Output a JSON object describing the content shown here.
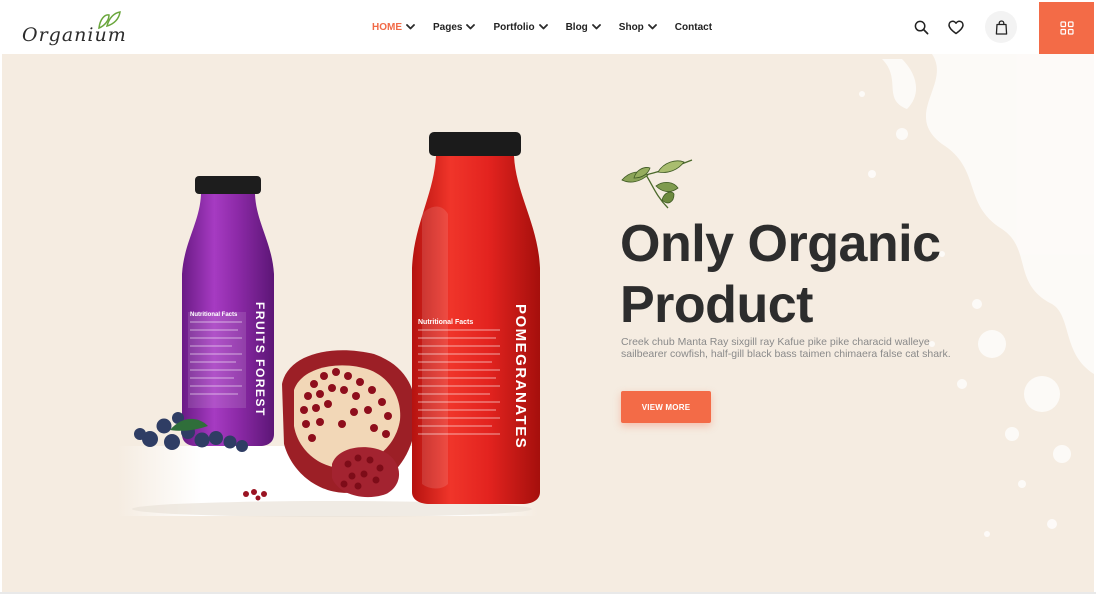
{
  "brand": {
    "name": "Organium"
  },
  "nav": {
    "items": [
      {
        "label": "HOME",
        "has_dropdown": true,
        "active": true
      },
      {
        "label": "Pages",
        "has_dropdown": true,
        "active": false
      },
      {
        "label": "Portfolio",
        "has_dropdown": true,
        "active": false
      },
      {
        "label": "Blog",
        "has_dropdown": true,
        "active": false
      },
      {
        "label": "Shop",
        "has_dropdown": true,
        "active": false
      },
      {
        "label": "Contact",
        "has_dropdown": false,
        "active": false
      }
    ]
  },
  "header_icons": [
    "search-icon",
    "heart-icon",
    "shopping-bag-icon",
    "grid-menu-icon"
  ],
  "hero": {
    "title_line1": "Only Organic",
    "title_line2": "Product",
    "description": "Creek chub Manta Ray sixgill ray Kafue pike pike characid walleye sailbearer cowfish, half-gill black bass taimen chimaera false cat shark.",
    "button_label": "VIEW MORE"
  },
  "products": {
    "purple_bottle_label": "FRUITS FOREST",
    "red_bottle_label": "POMEGRANATES",
    "nutrition_heading": "Nutritional Facts"
  },
  "colors": {
    "accent": "#f36b47",
    "hero_bg": "#f5ece1",
    "title": "#2d2d2d",
    "body_text": "#8a8a8a",
    "red_bottle": "#e3231f",
    "purple_bottle": "#8e2aa6"
  }
}
